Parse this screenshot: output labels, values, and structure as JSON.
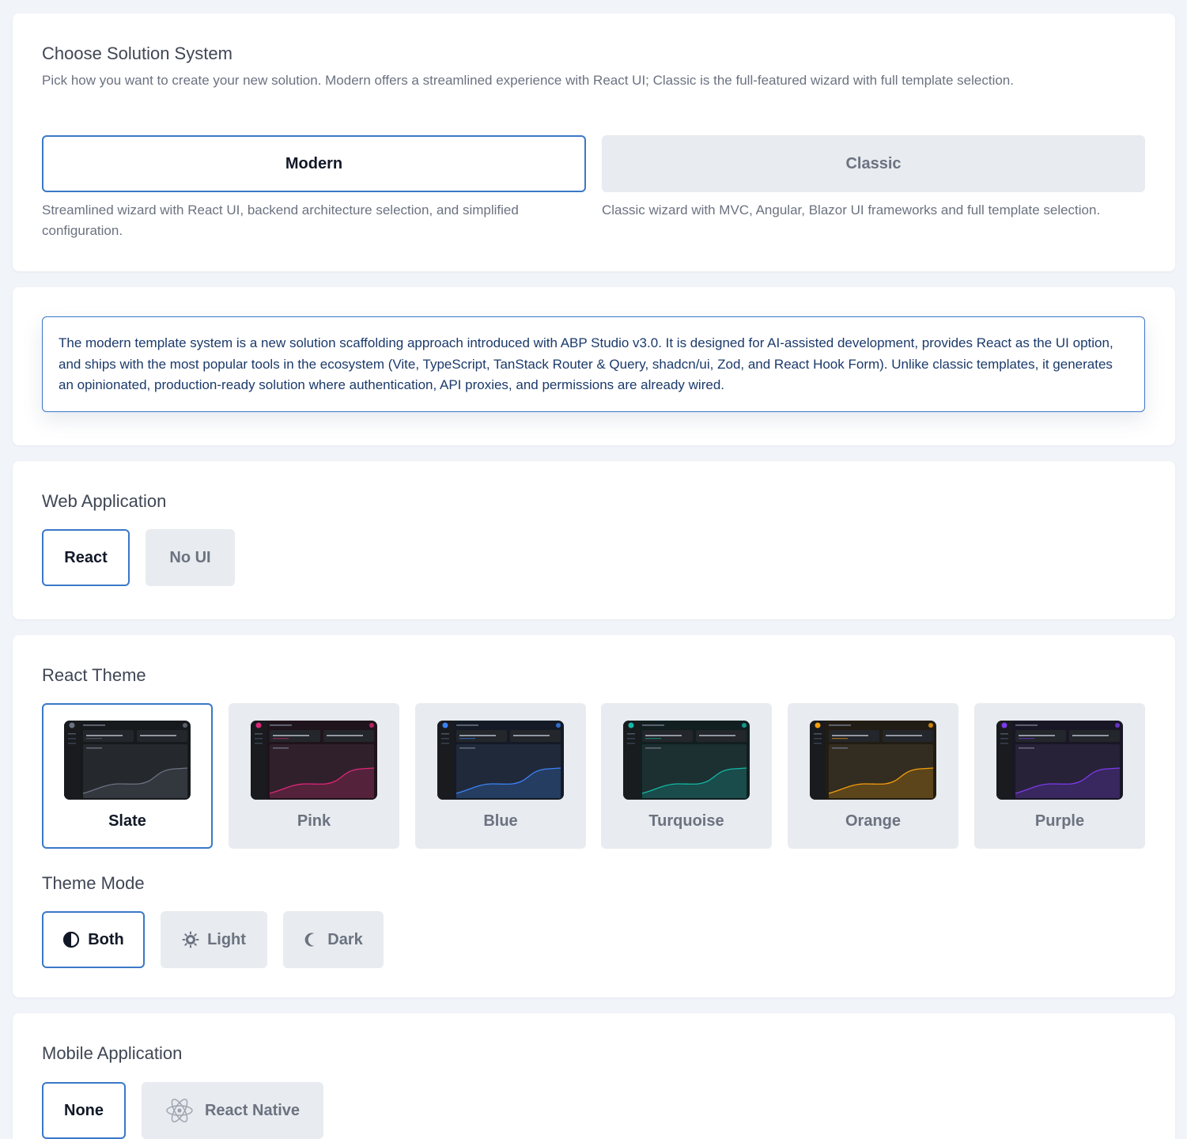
{
  "solution_system": {
    "title": "Choose Solution System",
    "description": "Pick how you want to create your new solution. Modern offers a streamlined experience with React UI; Classic is the full-featured wizard with full template selection.",
    "options": [
      {
        "label": "Modern",
        "description": "Streamlined wizard with React UI, backend architecture selection, and simplified configuration.",
        "selected": true
      },
      {
        "label": "Classic",
        "description": "Classic wizard with MVC, Angular, Blazor UI frameworks and full template selection.",
        "selected": false
      }
    ]
  },
  "info": {
    "text": "The modern template system is a new solution scaffolding approach introduced with ABP Studio v3.0. It is designed for AI-assisted development, provides React as the UI option, and ships with the most popular tools in the ecosystem (Vite, TypeScript, TanStack Router & Query, shadcn/ui, Zod, and React Hook Form). Unlike classic templates, it generates an opinionated, production-ready solution where authentication, API proxies, and permissions are already wired."
  },
  "web_application": {
    "title": "Web Application",
    "options": [
      {
        "label": "React",
        "selected": true
      },
      {
        "label": "No UI",
        "selected": false
      }
    ]
  },
  "react_theme": {
    "title": "React Theme",
    "themes": [
      {
        "label": "Slate",
        "accent": "#6b7280",
        "selected": true
      },
      {
        "label": "Pink",
        "accent": "#db2777",
        "selected": false
      },
      {
        "label": "Blue",
        "accent": "#3b82f6",
        "selected": false
      },
      {
        "label": "Turquoise",
        "accent": "#14b8a6",
        "selected": false
      },
      {
        "label": "Orange",
        "accent": "#f59e0b",
        "selected": false
      },
      {
        "label": "Purple",
        "accent": "#7c3aed",
        "selected": false
      }
    ]
  },
  "theme_mode": {
    "title": "Theme Mode",
    "options": [
      {
        "label": "Both",
        "icon": "half-circle-icon",
        "selected": true
      },
      {
        "label": "Light",
        "icon": "sun-icon",
        "selected": false
      },
      {
        "label": "Dark",
        "icon": "moon-icon",
        "selected": false
      }
    ]
  },
  "mobile_application": {
    "title": "Mobile Application",
    "options": [
      {
        "label": "None",
        "selected": true
      },
      {
        "label": "React Native",
        "icon": "react-icon",
        "selected": false
      }
    ]
  }
}
